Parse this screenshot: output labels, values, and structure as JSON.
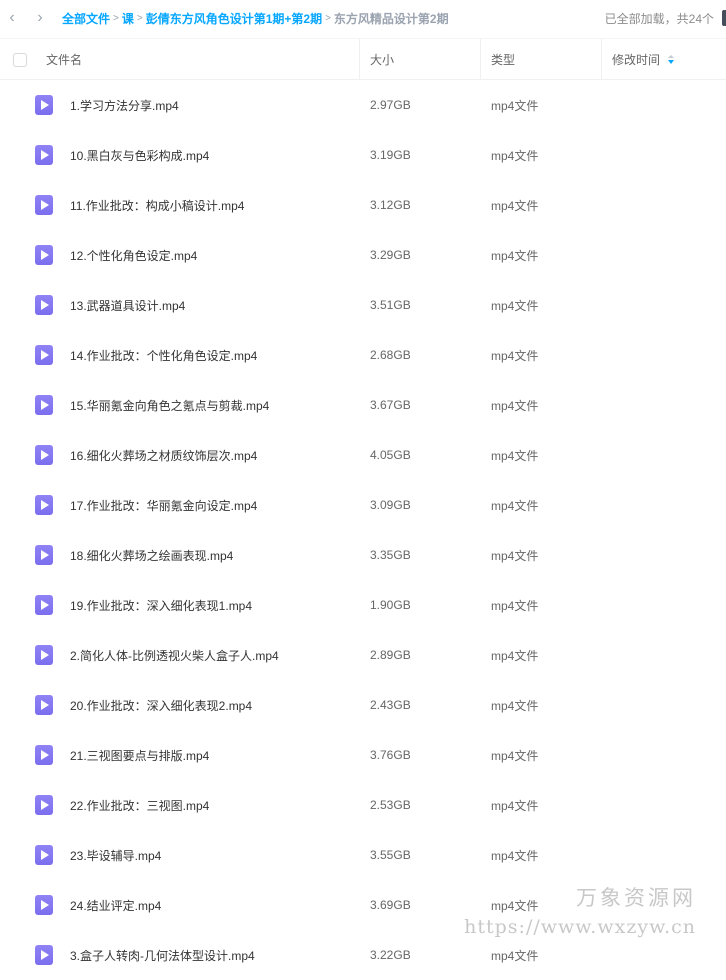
{
  "toolbar": {
    "back_icon": "chevron-left-icon",
    "forward_icon": "chevron-right-icon"
  },
  "breadcrumb": {
    "items": [
      "全部文件",
      "课",
      "彭倩东方风角色设计第1期+第2期"
    ],
    "current": "东方风精品设计第2期",
    "separator": ">"
  },
  "status": {
    "load_text": "已全部加载，共24个"
  },
  "table": {
    "columns": {
      "name": "文件名",
      "size": "大小",
      "type": "类型",
      "mtime": "修改时间"
    },
    "rows": [
      {
        "name": "1.学习方法分享.mp4",
        "size": "2.97GB",
        "type": "mp4文件"
      },
      {
        "name": "10.黑白灰与色彩构成.mp4",
        "size": "3.19GB",
        "type": "mp4文件"
      },
      {
        "name": "11.作业批改：构成小稿设计.mp4",
        "size": "3.12GB",
        "type": "mp4文件"
      },
      {
        "name": "12.个性化角色设定.mp4",
        "size": "3.29GB",
        "type": "mp4文件"
      },
      {
        "name": "13.武器道具设计.mp4",
        "size": "3.51GB",
        "type": "mp4文件"
      },
      {
        "name": "14.作业批改：个性化角色设定.mp4",
        "size": "2.68GB",
        "type": "mp4文件"
      },
      {
        "name": "15.华丽氪金向角色之氪点与剪裁.mp4",
        "size": "3.67GB",
        "type": "mp4文件"
      },
      {
        "name": "16.细化火葬场之材质纹饰层次.mp4",
        "size": "4.05GB",
        "type": "mp4文件"
      },
      {
        "name": "17.作业批改：华丽氪金向设定.mp4",
        "size": "3.09GB",
        "type": "mp4文件"
      },
      {
        "name": "18.细化火葬场之绘画表现.mp4",
        "size": "3.35GB",
        "type": "mp4文件"
      },
      {
        "name": "19.作业批改：深入细化表现1.mp4",
        "size": "1.90GB",
        "type": "mp4文件"
      },
      {
        "name": "2.简化人体-比例透视火柴人盒子人.mp4",
        "size": "2.89GB",
        "type": "mp4文件"
      },
      {
        "name": "20.作业批改：深入细化表现2.mp4",
        "size": "2.43GB",
        "type": "mp4文件"
      },
      {
        "name": "21.三视图要点与排版.mp4",
        "size": "3.76GB",
        "type": "mp4文件"
      },
      {
        "name": "22.作业批改：三视图.mp4",
        "size": "2.53GB",
        "type": "mp4文件"
      },
      {
        "name": "23.毕设辅导.mp4",
        "size": "3.55GB",
        "type": "mp4文件"
      },
      {
        "name": "24.结业评定.mp4",
        "size": "3.69GB",
        "type": "mp4文件"
      },
      {
        "name": "3.盒子人转肉-几何法体型设计.mp4",
        "size": "3.22GB",
        "type": "mp4文件"
      }
    ]
  },
  "watermark": {
    "title": "万象资源网",
    "url": "https://www.wxzyw.cn"
  },
  "colors": {
    "accent": "#06a7ff",
    "video_icon": "#7c6fee",
    "muted": "#9aa3af"
  }
}
